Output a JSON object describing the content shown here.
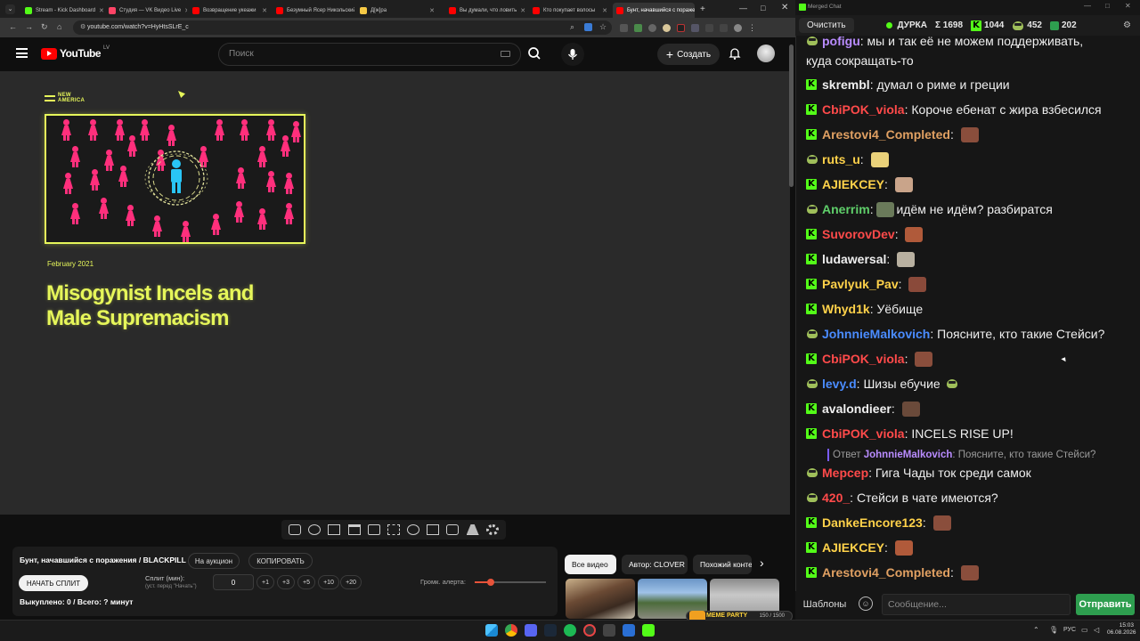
{
  "browser": {
    "tabs": [
      {
        "title": "Stream - Kick Dashboard",
        "color": "#53fc18"
      },
      {
        "title": "Студия — VK Видео Live",
        "color": "#ff4466"
      },
      {
        "title": "Возвращение укеажи",
        "color": "#ff0000"
      },
      {
        "title": "Безумный Ясер Никольский",
        "color": "#ff0000"
      },
      {
        "title": "Д[ж]ра",
        "color": "#f6c945"
      },
      {
        "title": "Вы думали, что ловить",
        "color": "#ff0000"
      },
      {
        "title": "Кто покупает волосы",
        "color": "#ff0000"
      },
      {
        "title": "Бунт, начавшийся с поражения",
        "color": "#ff0000"
      }
    ],
    "new_tab": "+",
    "url": "youtube.com/watch?v=HyHtsSLrE_c"
  },
  "youtube": {
    "logo_text": "YouTube",
    "region": "LV",
    "search_placeholder": "Поиск",
    "create_label": "Создать"
  },
  "video": {
    "org_logo": "NEW AMERICA",
    "date": "February 2021",
    "title": "Misogynist Incels and Male Supremacism"
  },
  "extension": {
    "stream_title": "Бунт, начавшийся с поражения / BLACKPILL",
    "auction_label": "На аукцион",
    "copy_label": "КОПИРОВАТЬ",
    "start_split_label": "НАЧАТЬ СПЛИТ",
    "split_label": "Сплит (мин):",
    "split_hint": "(уст. перед \"Начать\")",
    "split_value": "0",
    "steps": [
      "+1",
      "+3",
      "+5",
      "+10",
      "+20"
    ],
    "alert_volume_label": "Громк. алерта:",
    "alert_volume": 0.23,
    "bought_text": "Выкуплено: 0 / Всего: ? минут"
  },
  "chips": [
    "Все видео",
    "Автор: CLOVER",
    "Похожий контент"
  ],
  "thumbs": {
    "meme_label": "MEME PARTY",
    "counter": "150 / 1500"
  },
  "chat": {
    "window_title": "Merged Chat",
    "clear_label": "Очистить",
    "channel": "ДУРКА",
    "stats": [
      {
        "icon": "sigma",
        "value": "Σ 1698"
      },
      {
        "icon": "kick-icon",
        "value": "1044"
      },
      {
        "icon": "frog-icon",
        "value": "452"
      },
      {
        "icon": "vk-icon",
        "value": "202"
      }
    ],
    "messages": [
      {
        "platform": "vk",
        "user": "pofigu",
        "color": "#b98cff",
        "text": "мы и так её не можем поддерживать,"
      },
      {
        "platform": "none",
        "user": "",
        "color": "#efefef",
        "text": "куда сокращать-то"
      },
      {
        "platform": "kick",
        "user": "skrembl",
        "color": "#efefef",
        "text": "думал о риме и греции"
      },
      {
        "platform": "kick",
        "user": "CbiPOK_viola",
        "color": "#ff4a4a",
        "text": "Короче ебенат с жира взбесился"
      },
      {
        "platform": "kick",
        "user": "Arestovi4_Completed",
        "color": "#e0a062",
        "text": "",
        "emote": "#8a4e3c"
      },
      {
        "platform": "vk",
        "user": "ruts_u",
        "color": "#ffd24a",
        "text": "",
        "emote": "#e9d17a"
      },
      {
        "platform": "kick",
        "user": "AJIEKCEY",
        "color": "#ffd24a",
        "text": "",
        "emote": "#c9a48a"
      },
      {
        "platform": "vk",
        "user": "Anerrim",
        "color": "#5fcf6a",
        "text": "идём не идём? разбиратся",
        "emote_before": "#6a7a5a"
      },
      {
        "platform": "kick",
        "user": "SuvorovDev",
        "color": "#ff4a4a",
        "text": "",
        "emote": "#b05a3a"
      },
      {
        "platform": "kick",
        "user": "ludawersal",
        "color": "#efefef",
        "text": "",
        "emote": "#b8b0a0"
      },
      {
        "platform": "kick",
        "user": "Pavlyuk_Pav",
        "color": "#ffd24a",
        "text": "",
        "emote": "#8a4a3a"
      },
      {
        "platform": "kick",
        "user": "Whyd1k",
        "color": "#ffd24a",
        "text": "Уёбище"
      },
      {
        "platform": "vk",
        "user": "JohnnieMalkovich",
        "color": "#4a8cff",
        "text": "Поясните, кто такие Стейси?"
      },
      {
        "platform": "kick",
        "user": "CbiPOK_viola",
        "color": "#ff4a4a",
        "text": "",
        "emote": "#8a4e3c"
      },
      {
        "platform": "vk",
        "user": "levy.d",
        "color": "#4a8cff",
        "text": "Шизы ебучие",
        "emote_after": "#9fbf5a"
      },
      {
        "platform": "kick",
        "user": "avalondieer",
        "color": "#efefef",
        "text": "",
        "emote": "#6a4a3a"
      },
      {
        "platform": "kick",
        "user": "CbiPOK_viola",
        "color": "#ff4a4a",
        "text": "INCELS RISE UP!"
      },
      {
        "platform": "reply",
        "prefix": "Ответ",
        "user": "JohnnieMalkovich",
        "text": "Поясните, кто такие Стейси?"
      },
      {
        "platform": "vk",
        "user": "Мерсер",
        "color": "#ff4a4a",
        "text": "Гига Чады ток среди самок"
      },
      {
        "platform": "vk",
        "user": "420_",
        "color": "#ff4a4a",
        "text": "Стейси в чате имеются?"
      },
      {
        "platform": "kick",
        "user": "DankeEncore123",
        "color": "#ffd24a",
        "text": "",
        "emote": "#8a4e3c"
      },
      {
        "platform": "kick",
        "user": "AJIEKCEY",
        "color": "#ffd24a",
        "text": "",
        "emote": "#b05a3a"
      },
      {
        "platform": "kick",
        "user": "Arestovi4_Completed",
        "color": "#e0a062",
        "text": "",
        "emote": "#8a4e3c"
      }
    ],
    "templates_label": "Шаблоны",
    "input_placeholder": "Сообщение...",
    "send_label": "Отправить"
  },
  "taskbar": {
    "lang": "РУС",
    "time": "15:03",
    "date": "06.08.2026"
  },
  "colors": {
    "accent_yellow": "#e6f65a",
    "figure_pink": "#ff2f7c",
    "figure_blue": "#29c5f6",
    "kick_green": "#53fc18",
    "send_green": "#2e9e4f"
  }
}
